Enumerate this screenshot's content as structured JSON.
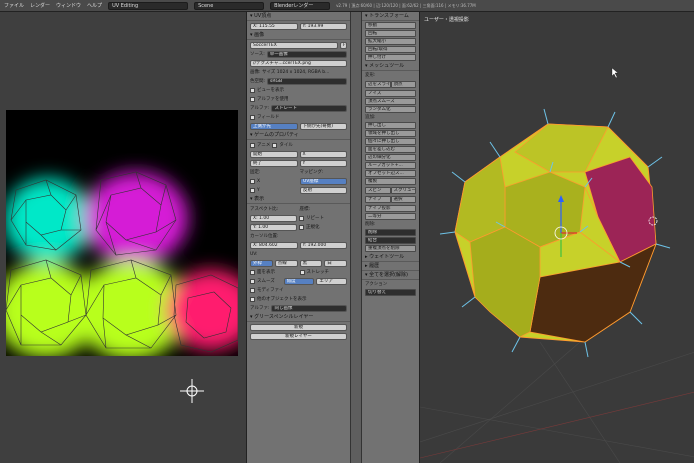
{
  "topbar": {
    "menu": [
      "ファイル",
      "レンダー",
      "ウィンドウ",
      "ヘルプ"
    ],
    "layout": "UV Editing",
    "scene": "Scene",
    "engine": "Blenderレンダー",
    "info": "v2.79 | 頂点:60/60 | 辺:120/120 | 面:62/62 | 三角面:116 | メモリ:36.77M"
  },
  "props": {
    "uv_header": "UV頂点",
    "uv_x": "X:",
    "uv_x_val": "115.55",
    "uv_y": "Y:",
    "uv_y_val": "193.99",
    "image_header": "画像",
    "image_name": "SoccerTEX",
    "image_f": "F",
    "source_label": "ソース:",
    "source_val": "単一画像",
    "file_path": "//テクスチャ...ccerTEX.png",
    "image_info": "画像: サイズ 1024 x 1024, RGBA b...",
    "colorspace_label": "色空間:",
    "colorspace_val": "sRGB",
    "view_as_render": "ビューを表示",
    "use_alpha": "アルファを使用",
    "alpha_label": "アルファ:",
    "alpha_val": "ストレート",
    "fields": "フィールド",
    "fields_a": "上側が先",
    "fields_b": "下側が先(奇数)",
    "game_header": "ゲームのプロパティ",
    "animation": "アニメ",
    "tiles": "タイル",
    "start": "開始",
    "end": "終了",
    "tiles_x": "X",
    "tiles_y": "Y",
    "clamp": "固定:",
    "clamp_x": "X",
    "clamp_y": "Y",
    "mapping": "マッピング:",
    "map_uv": "UV座標",
    "map_reflect": "反射",
    "display_header": "表示",
    "aspect": "アスペクト比:",
    "aspect_x": "X:",
    "aspect_x_val": "1.00",
    "aspect_y": "Y:",
    "aspect_y_val": "1.00",
    "coords": "座標:",
    "repeat": "リピート",
    "normalized": "正規化",
    "cursor": "カーソル位置:",
    "cursor_x": "X:",
    "cursor_x_val": "804.602",
    "cursor_y": "Y:",
    "cursor_y_val": "192.000",
    "uv_section": "UV:",
    "uv_outline": "外枠",
    "uv_dash": "点線",
    "uv_black": "黒",
    "uv_white": "白",
    "draw_faces": "面を表示",
    "stretch": "ストレッチ",
    "smooth": "スムーズ",
    "angle": "角度",
    "area": "エリア",
    "modified": "モディファイ",
    "other_objects": "他のオブジェクトを表示",
    "alpha_row": "アルファ:",
    "alpha_row_val": "同じ画像",
    "gp_header": "グリースペンシルレイヤー",
    "gp_new": "新規",
    "gp_new_layer": "新規レイヤー"
  },
  "tools": {
    "transform_header": "トランスフォーム",
    "transform": [
      "移動",
      "回転",
      "拡大縮小",
      "回転/取得",
      "押し付け"
    ],
    "mesh_header": "メッシュツール",
    "deform_label": "変形:",
    "deform_a": "辺をスライド",
    "deform_b": "頂点",
    "deform": [
      "ノイズ",
      "頂点スムーズ",
      "ランダム化"
    ],
    "add_label": "追加:",
    "add": [
      "押し出し",
      "領域を押し出し",
      "個々に押し出し",
      "面を差し込む",
      "辺の細分化",
      "ループカット+...",
      "オフセット辺ス...",
      "複製",
      "スピン",
      "スクリュー",
      "ナイフ",
      "選択",
      "ナイフ投影",
      "二等分"
    ],
    "remove_label": "削除:",
    "remove": [
      "削除",
      "結合",
      "重複頂点を削除"
    ],
    "weight_header": "ウェイトツール",
    "history_header": "履歴",
    "select_all_header": "全てを選択(解除)",
    "action": "アクション",
    "action_val": "切り替え"
  },
  "view3d": {
    "title": "ユーザー・透視投影"
  },
  "colors": {
    "accent": "#5680c2",
    "mesh": "#c7d12a",
    "mesh_shade": "#a9b11e",
    "magenta": "#9c2456",
    "brown": "#4d2b10",
    "edge": "#ff9a2e"
  }
}
